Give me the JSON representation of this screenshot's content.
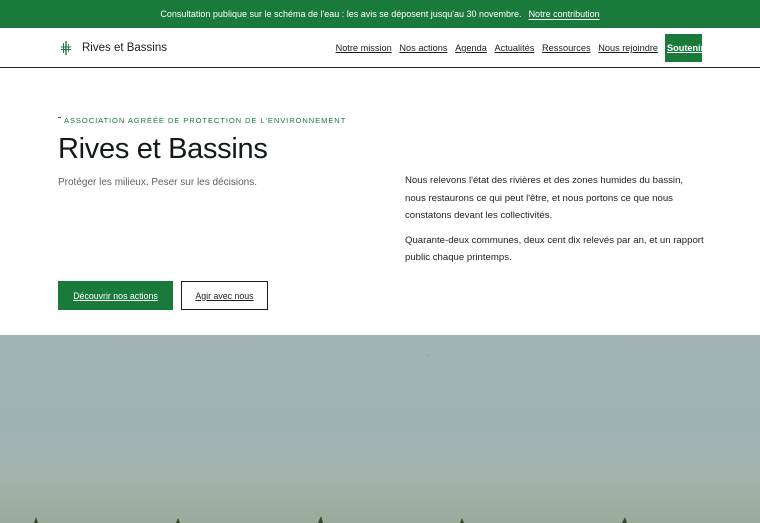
{
  "announcement": {
    "text": "Consultation publique sur le schéma de l'eau : les avis se déposent jusqu'au 30 novembre.",
    "link": "Notre contribution"
  },
  "header": {
    "brand": "Rives et Bassins",
    "logo_icon": "reed-icon",
    "nav": [
      "Notre mission",
      "Nos actions",
      "Agenda",
      "Actualités",
      "Ressources",
      "Nous rejoindre"
    ],
    "cta": "Soutenir"
  },
  "hero": {
    "eyebrow": "ASSOCIATION AGRÉÉE DE PROTECTION DE L'ENVIRONNEMENT",
    "title": "Rives et Bassins",
    "subtitle": "Protéger les milieux. Peser sur les décisions.",
    "body": [
      "Nous relevons l'état des rivières et des zones humides du bassin, nous restaurons ce qui peut l'être, et nous portons ce que nous constatons devant les collectivités.",
      "Quarante-deux communes, deux cent dix relevés par an, et un rapport public chaque printemps."
    ],
    "primary_button": "Découvrir nos actions",
    "secondary_button": "Agir avec nous"
  },
  "colors": {
    "accent": "#1a7a3c",
    "photo_sky": "#a2b3b4"
  }
}
